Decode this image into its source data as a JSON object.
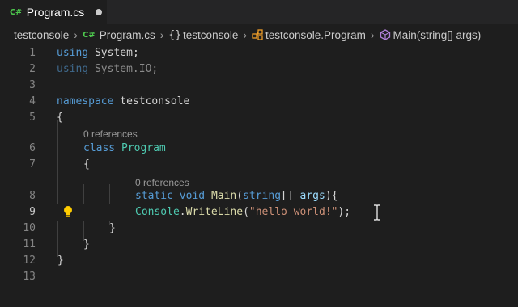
{
  "tab": {
    "icon": "C#",
    "label": "Program.cs"
  },
  "breadcrumb": {
    "items": [
      {
        "label": "testconsole",
        "icon": ""
      },
      {
        "label": "Program.cs",
        "icon": "C#"
      },
      {
        "label": "testconsole",
        "icon": "{}"
      },
      {
        "label": "testconsole.Program",
        "icon": "class-icon"
      },
      {
        "label": "Main(string[] args)",
        "icon": "method-icon"
      }
    ],
    "separator": "›"
  },
  "editor": {
    "codelens_text": "0 references",
    "current_line": 9,
    "lines": [
      {
        "n": "1"
      },
      {
        "n": "2"
      },
      {
        "n": "3"
      },
      {
        "n": "4"
      },
      {
        "n": "5"
      },
      {
        "n": "6"
      },
      {
        "n": "7"
      },
      {
        "n": "8"
      },
      {
        "n": "9"
      },
      {
        "n": "10"
      },
      {
        "n": "11"
      },
      {
        "n": "12"
      },
      {
        "n": "13"
      }
    ],
    "tokens": {
      "using": "using",
      "system": "System",
      "semicolon": ";",
      "system_io": "System.IO",
      "namespace": "namespace",
      "testconsole": "testconsole",
      "open_brace": "{",
      "close_brace": "}",
      "class": "class",
      "program": "Program",
      "static": "static",
      "void": "void",
      "main": "Main",
      "open_paren": "(",
      "string": "string",
      "brackets": "[] ",
      "args": "args",
      "close_paren_brace": "){",
      "console": "Console",
      "dot": ".",
      "writeline": "WriteLine",
      "string_literal": "\"hello world!\"",
      "close_stmt": ");"
    }
  },
  "colors": {
    "background": "#1e1e1e",
    "keyword": "#569cd6",
    "type": "#4ec9b0",
    "function": "#dcdcaa",
    "parameter": "#9cdcfe",
    "string": "#ce9178",
    "csharp_icon": "#4ec94e",
    "lightbulb": "#ffcc00"
  }
}
